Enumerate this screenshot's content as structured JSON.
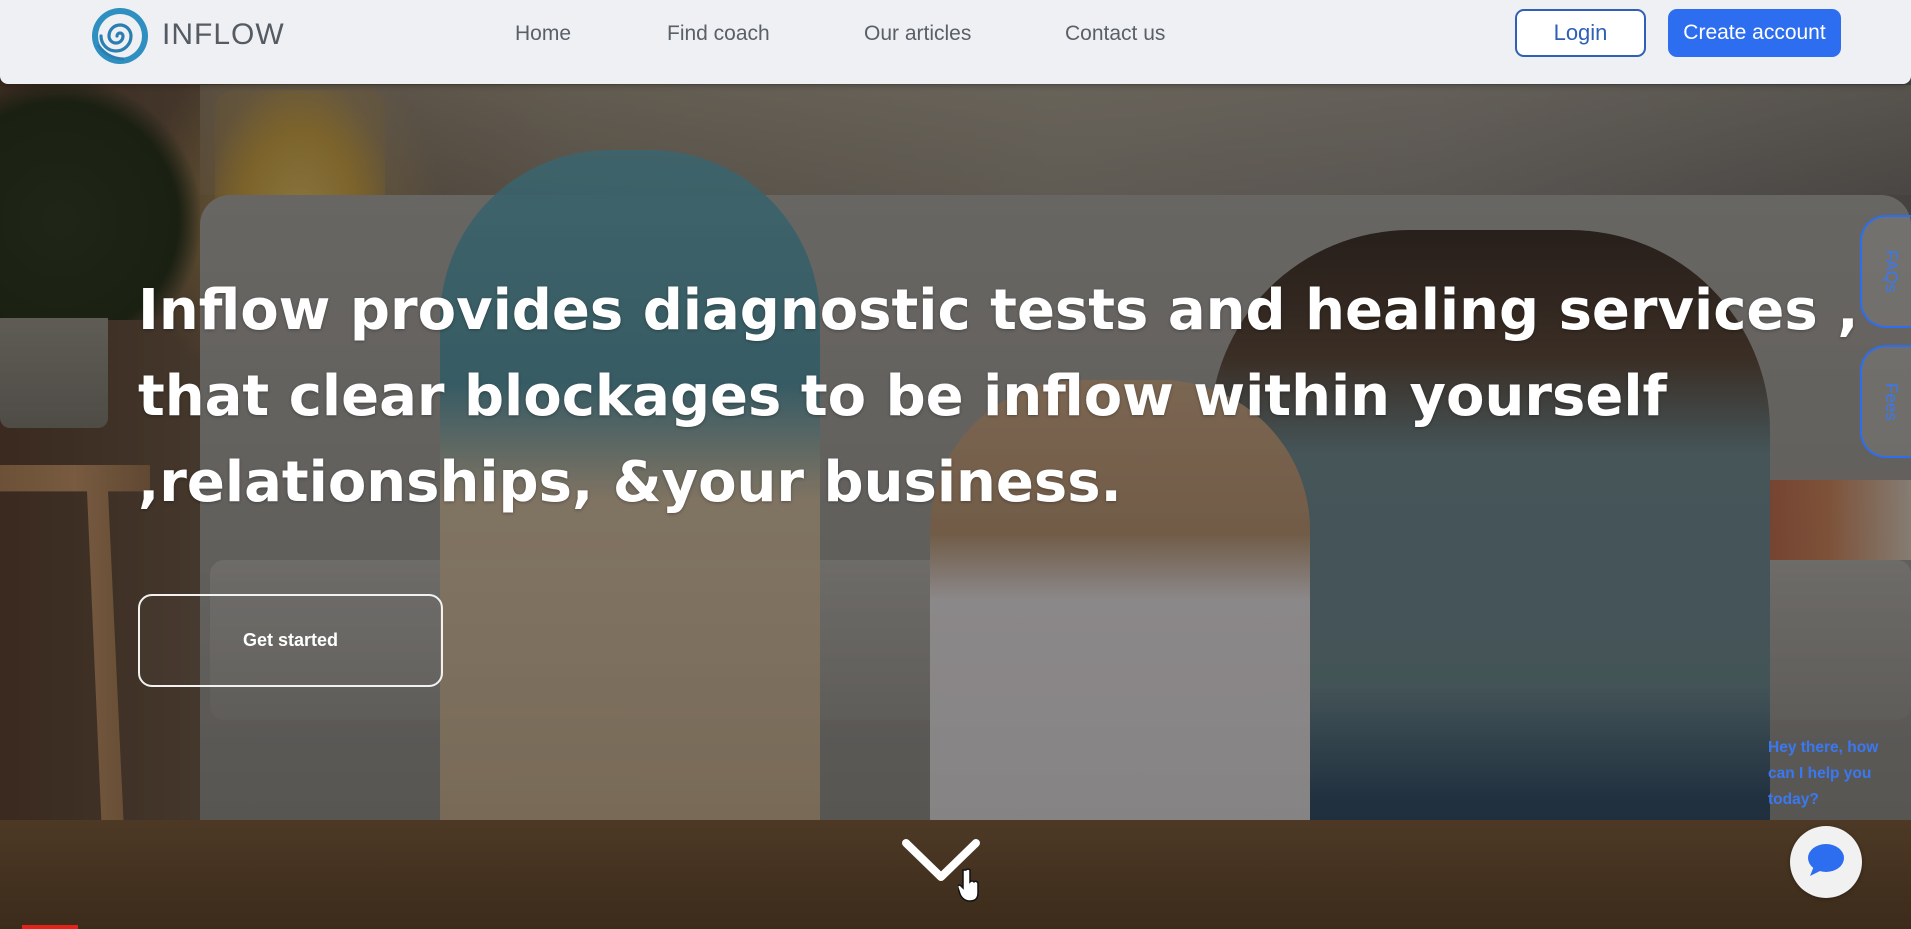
{
  "brand": {
    "name": "INFLOW",
    "logo_icon": "spiral-logo-icon"
  },
  "nav": {
    "links": [
      {
        "label": "Home"
      },
      {
        "label": "Find coach"
      },
      {
        "label": "Our articles"
      },
      {
        "label": "Contact us"
      }
    ],
    "login_label": "Login",
    "create_account_label": "Create account"
  },
  "hero": {
    "headline_bold": "Inflow",
    "headline_line1": " provides diagnostic tests and healing services ,",
    "headline_line2": "that clear blockages to be inflow within yourself",
    "headline_line3": ",relationships, &your business.",
    "cta_label": "Get started",
    "scroll_icon": "chevron-down-icon"
  },
  "side_tabs": [
    {
      "label": "FAQs"
    },
    {
      "label": "Fees"
    }
  ],
  "chat": {
    "message": "Hey there, how can I help you today?",
    "icon": "chat-bubble-icon"
  },
  "colors": {
    "accent": "#2d6ef0",
    "login_border": "#2f5fb7",
    "nav_bg": "#eef0f4",
    "chat_text": "#3a78f2"
  }
}
